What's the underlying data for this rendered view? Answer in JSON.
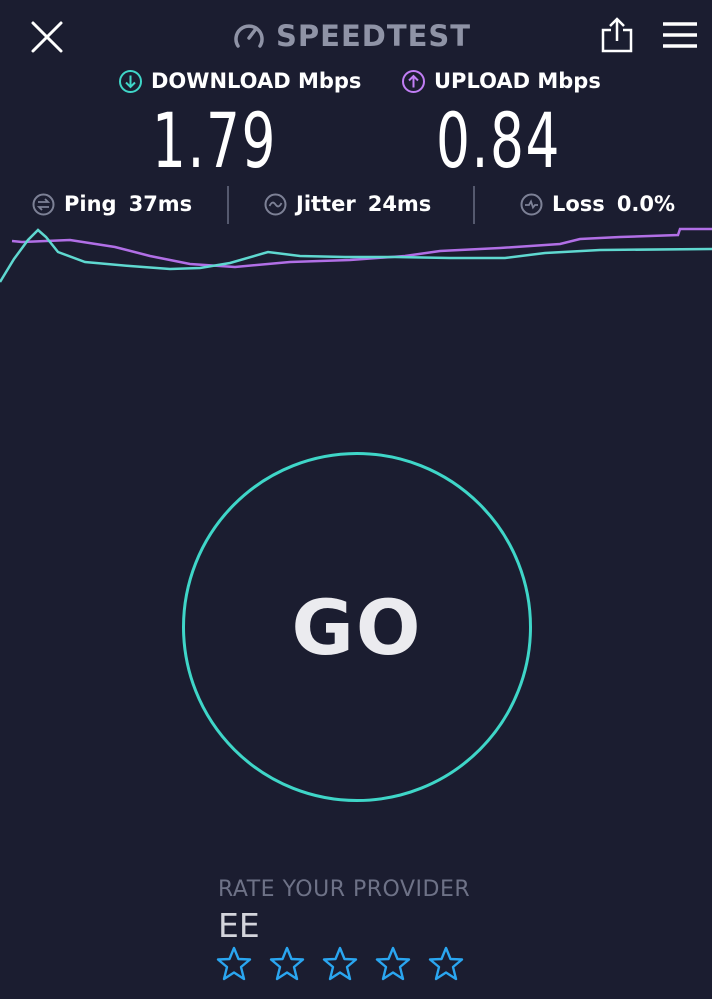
{
  "header": {
    "title": "SPEEDTEST",
    "close_icon": "close-icon",
    "share_icon": "share-icon",
    "menu_icon": "menu-icon"
  },
  "download": {
    "label": "DOWNLOAD Mbps",
    "value": "1.79",
    "icon": "download-arrow-icon",
    "color": "#3fd6c8"
  },
  "upload": {
    "label": "UPLOAD Mbps",
    "value": "0.84",
    "icon": "upload-arrow-icon",
    "color": "#c17ef5"
  },
  "stats": {
    "ping": {
      "label": "Ping",
      "value": "37ms",
      "icon": "ping-icon"
    },
    "jitter": {
      "label": "Jitter",
      "value": "24ms",
      "icon": "jitter-icon"
    },
    "loss": {
      "label": "Loss",
      "value": "0.0%",
      "icon": "loss-icon"
    }
  },
  "go_button": {
    "label": "GO",
    "color": "#3fd6c8"
  },
  "rating": {
    "title": "RATE YOUR PROVIDER",
    "provider": "EE",
    "max_stars": 5,
    "selected_stars": 0,
    "star_color": "#2aa6f0"
  },
  "colors": {
    "background": "#1b1d30",
    "header_text": "#8f93a6"
  }
}
